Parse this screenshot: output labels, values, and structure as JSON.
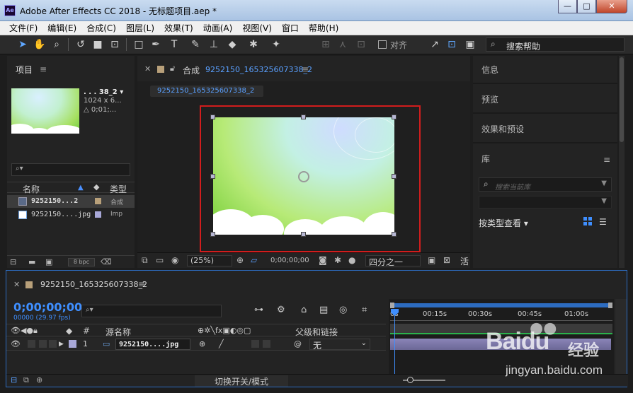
{
  "window": {
    "title": "Adobe After Effects CC 2018 - 无标题项目.aep *",
    "app_icon": "Ae"
  },
  "menu": [
    "文件(F)",
    "编辑(E)",
    "合成(C)",
    "图层(L)",
    "效果(T)",
    "动画(A)",
    "视图(V)",
    "窗口",
    "帮助(H)"
  ],
  "toolbar": {
    "snap_label": "对齐",
    "help_search": "搜索帮助"
  },
  "project": {
    "title": "项目",
    "thumb_name": ". . . 38_2 ▾",
    "thumb_size": "1024 x 6...",
    "thumb_dur": "△ 0;01;...",
    "search_placeholder": "⌕▾",
    "col_name": "名称",
    "col_type": "类型",
    "rows": [
      {
        "name": "9252150...2",
        "type": "合成"
      },
      {
        "name": "9252150....jpg",
        "type": "Imp"
      }
    ],
    "bpc": "8 bpc"
  },
  "comp": {
    "tab_label": "合成",
    "tab_name": "9252150_165325607338_2",
    "subtab": "9252150_165325607338_2",
    "zoom": "(25%)",
    "timecode": "0;00;00;00",
    "resolution": "四分之一",
    "extra": "活"
  },
  "right_panel": {
    "items": [
      "信息",
      "预览",
      "效果和预设",
      "库"
    ],
    "lib_search_placeholder": "搜索当前库",
    "lib_view_label": "按类型查看"
  },
  "timeline": {
    "comp_name": "9252150_165325607338_2",
    "timecode": "0;00;00;00",
    "fps": "00000 (29.97 fps)",
    "search_placeholder": "⌕▾",
    "col_num": "#",
    "col_source": "源名称",
    "col_parent": "父级和链接",
    "layer": {
      "num": "1",
      "name": "9252150....jpg",
      "parent": "无"
    },
    "ticks": [
      "0s",
      "00:15s",
      "00:30s",
      "00:45s",
      "01:00s"
    ],
    "switch_label": "切换开关/模式"
  },
  "watermark": {
    "brand": "Baidu",
    "cn": "经验",
    "url": "jingyan.baidu.com"
  }
}
